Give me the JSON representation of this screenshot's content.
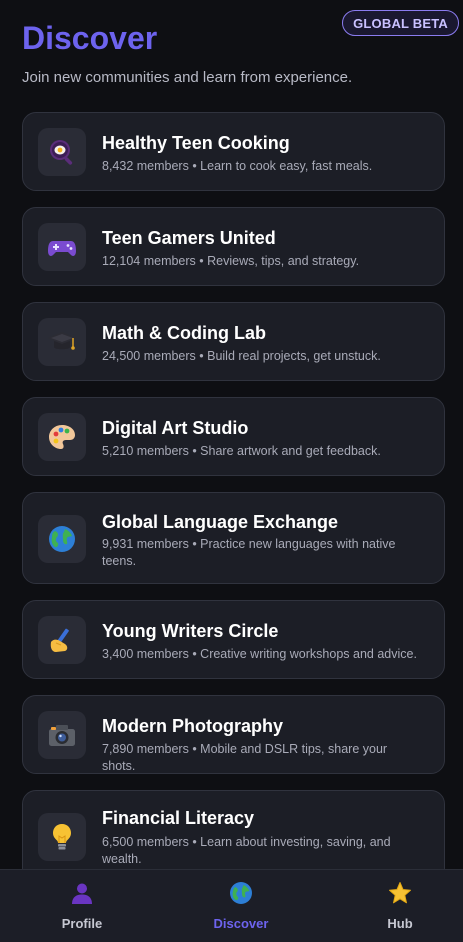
{
  "header": {
    "title": "Discover",
    "subtitle": "Join new communities and learn from experience.",
    "badge": "GLOBAL BETA"
  },
  "communities": [
    {
      "name": "Healthy Teen Cooking",
      "meta": "8,432 members • Learn to cook easy, fast meals.",
      "icon": "frying-pan-icon"
    },
    {
      "name": "Teen Gamers United",
      "meta": "12,104 members • Reviews, tips, and strategy.",
      "icon": "game-controller-icon"
    },
    {
      "name": "Math & Coding Lab",
      "meta": "24,500 members • Build real projects, get unstuck.",
      "icon": "graduation-cap-icon"
    },
    {
      "name": "Digital Art Studio",
      "meta": "5,210 members • Share artwork and get feedback.",
      "icon": "palette-icon"
    },
    {
      "name": "Global Language Exchange",
      "meta": "9,931 members • Practice new languages with native teens.",
      "icon": "globe-icon"
    },
    {
      "name": "Young Writers Circle",
      "meta": "3,400 members • Creative writing workshops and advice.",
      "icon": "writing-hand-icon"
    },
    {
      "name": "Modern Photography",
      "meta": "7,890 members • Mobile and DSLR tips, share your shots.",
      "icon": "camera-icon"
    },
    {
      "name": "Financial Literacy",
      "meta": "6,500 members • Learn about investing, saving, and wealth.",
      "icon": "lightbulb-icon"
    }
  ],
  "nav": {
    "profile": "Profile",
    "discover": "Discover",
    "hub": "Hub"
  },
  "colors": {
    "accent": "#6d63ee",
    "background": "#0e0f13",
    "card": "#1c1e26"
  }
}
